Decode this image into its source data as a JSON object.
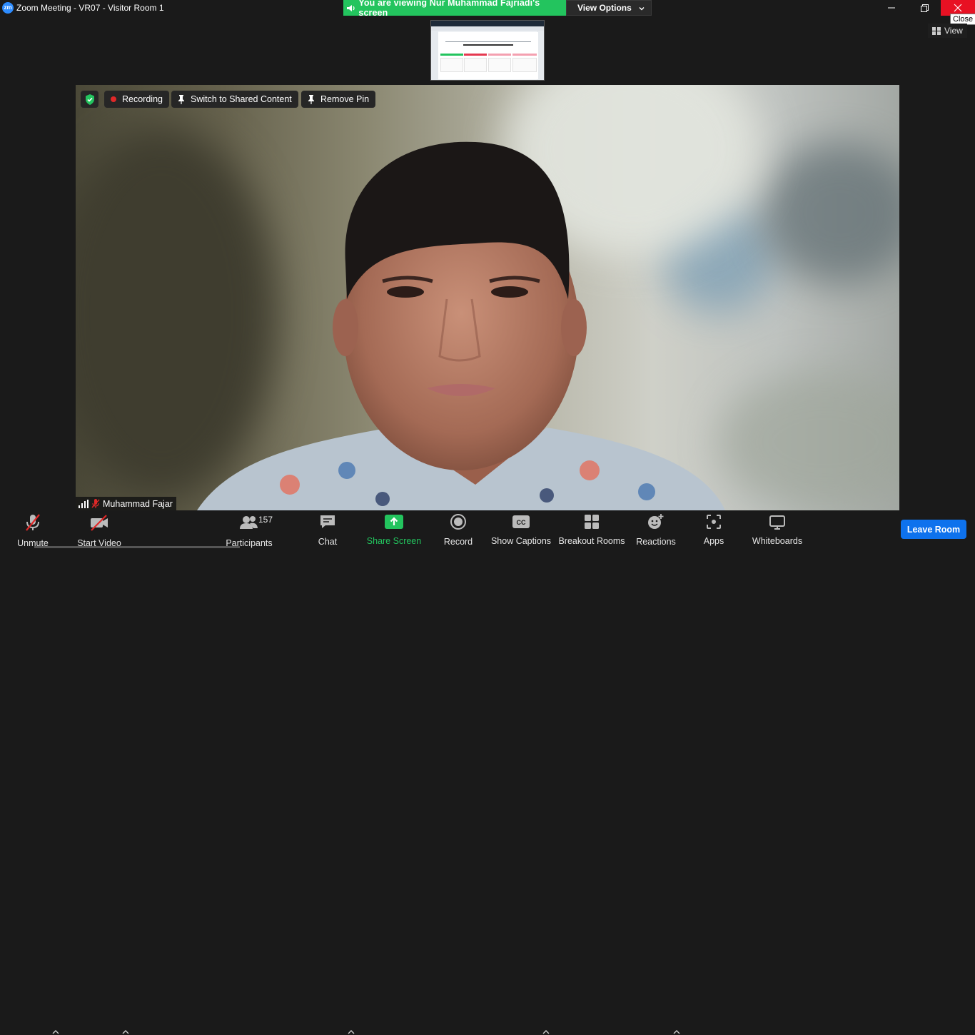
{
  "window": {
    "app_logo": "zm",
    "title": "Zoom Meeting - VR07 - Visitor Room 1",
    "close_tooltip": "Close"
  },
  "banner": {
    "viewing_text": "You are viewing Nur Muhammad Fajriadi's screen",
    "view_options_label": "View Options",
    "color": "#23c45e"
  },
  "top_right": {
    "view_label": "View"
  },
  "video_overlay": {
    "recording_label": "Recording",
    "switch_label": "Switch to Shared Content",
    "remove_pin_label": "Remove Pin"
  },
  "participant": {
    "name": "Muhammad Fajar"
  },
  "toolbar": {
    "unmute_label": "Unmute",
    "start_video_label": "Start Video",
    "participants_label": "Participants",
    "participants_count": "157",
    "chat_label": "Chat",
    "share_screen_label": "Share Screen",
    "record_label": "Record",
    "show_captions_label": "Show Captions",
    "breakout_rooms_label": "Breakout Rooms",
    "reactions_label": "Reactions",
    "apps_label": "Apps",
    "whiteboards_label": "Whiteboards",
    "leave_room_label": "Leave Room",
    "accent_color": "#0e72ed"
  }
}
